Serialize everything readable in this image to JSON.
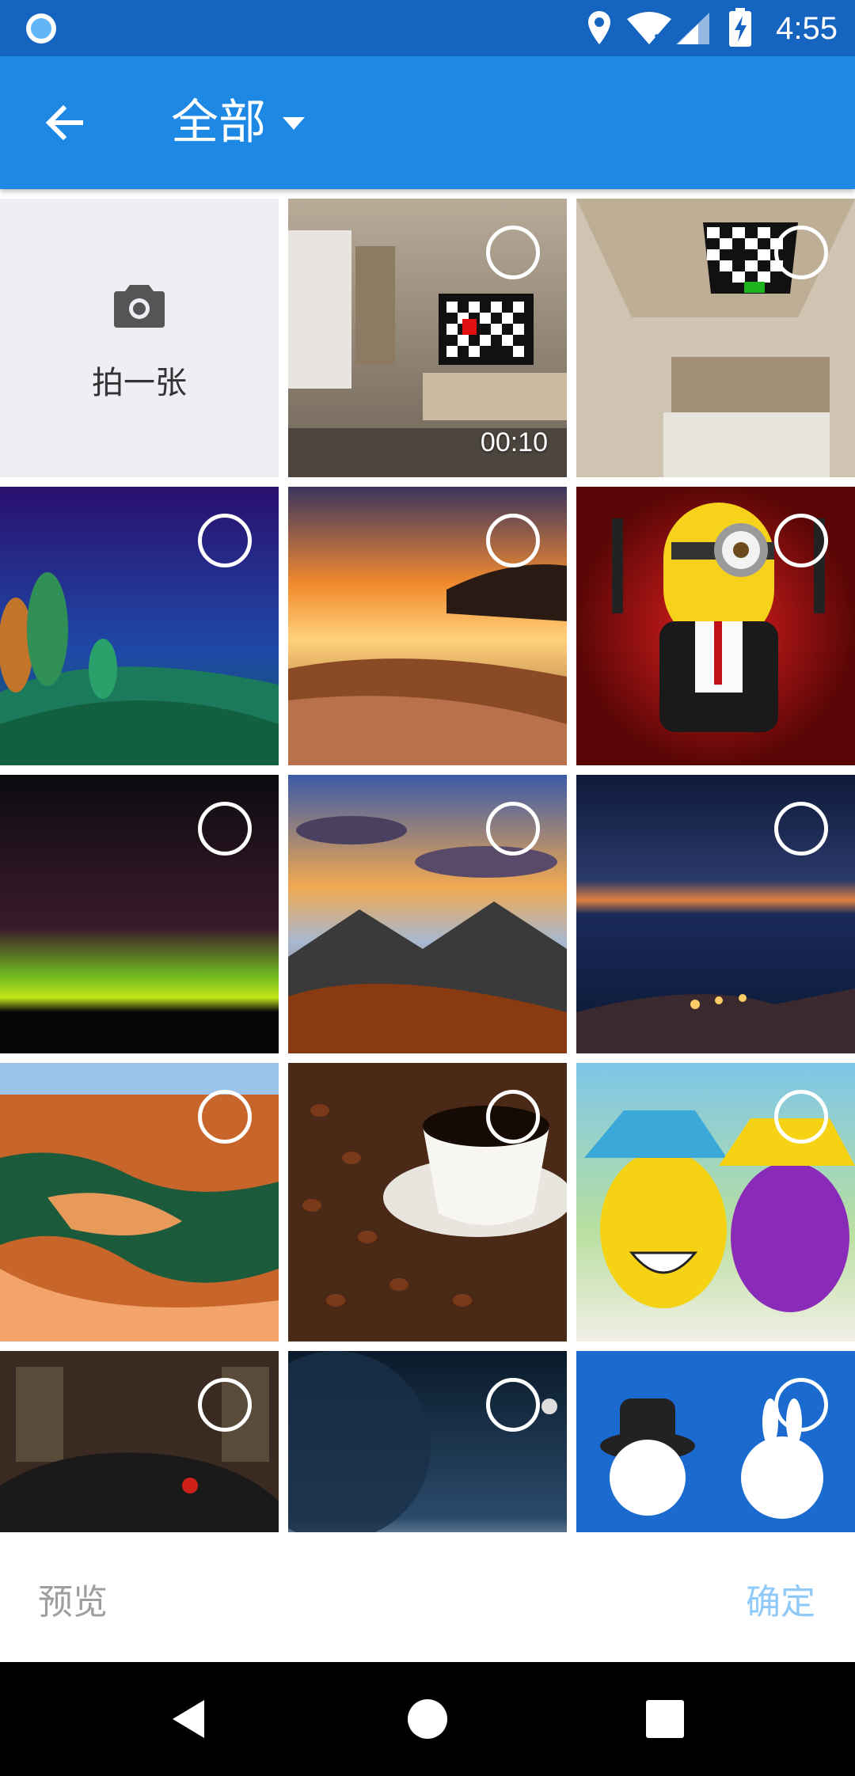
{
  "status_bar": {
    "time": "4:55",
    "icons": [
      "app-indicator-icon",
      "location-icon",
      "wifi-icon",
      "signal-icon",
      "battery-charging-icon"
    ]
  },
  "app_bar": {
    "back_icon": "arrow-back-icon",
    "title": "全部",
    "dropdown_icon": "dropdown-arrow-icon",
    "color": "#1E88E5",
    "status_color": "#1565C0"
  },
  "grid": {
    "camera_tile": {
      "icon": "camera-icon",
      "label": "拍一张"
    },
    "items": [
      {
        "kind": "video",
        "duration": "00:10",
        "subject": "room-with-tv"
      },
      {
        "kind": "image",
        "subject": "room-ceiling-checkerboard"
      },
      {
        "kind": "image",
        "subject": "green-hills-trees"
      },
      {
        "kind": "image",
        "subject": "beach-sunset"
      },
      {
        "kind": "image",
        "subject": "minion-with-guns"
      },
      {
        "kind": "image",
        "subject": "aurora-night-sky"
      },
      {
        "kind": "image",
        "subject": "mountains-clouds-sunset"
      },
      {
        "kind": "image",
        "subject": "coastal-town-night"
      },
      {
        "kind": "image",
        "subject": "canyon-river"
      },
      {
        "kind": "image",
        "subject": "coffee-cup-beans"
      },
      {
        "kind": "image",
        "subject": "painted-eggs-hats"
      },
      {
        "kind": "image",
        "subject": "black-sports-car"
      },
      {
        "kind": "image",
        "subject": "planet-space"
      },
      {
        "kind": "image",
        "subject": "cartoon-characters"
      }
    ]
  },
  "action_bar": {
    "preview_label": "预览",
    "confirm_label": "确定",
    "preview_color": "#9E9E9E",
    "confirm_color": "#90CAF9"
  },
  "nav_bar": {
    "icons": [
      "nav-back-icon",
      "nav-home-icon",
      "nav-recents-icon"
    ]
  }
}
